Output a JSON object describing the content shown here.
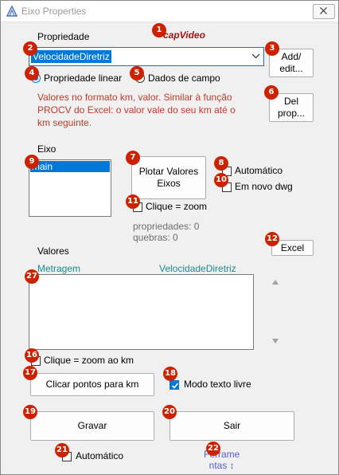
{
  "window": {
    "title": "Eixo Properties"
  },
  "brand": {
    "text": "capVideo"
  },
  "propriedade": {
    "label": "Propriedade",
    "selected": "VelocidadeDiretriz",
    "add_label": "Add/\nedit...",
    "option_linear": "Propriedade linear",
    "option_campo": "Dados de campo",
    "linear_checked": true,
    "info": "Valores no formato km, valor. Similar à função PROCV do Excel: o valor vale do seu km até o km seguinte.",
    "del_label": "Del\nprop..."
  },
  "eixo": {
    "label": "Eixo",
    "items": [
      "main"
    ],
    "plot_label": "Plotar Valores\nEixos",
    "automatico": "Automático",
    "em_novo_dwg": "Em novo dwg",
    "clique_zoom": "Clique = zoom",
    "propriedades": "propriedades: 0",
    "quebras": "quebras: 0"
  },
  "valores": {
    "label": "Valores",
    "excel_label": "Excel",
    "col_metragem": "Metragem",
    "col_valor": "VelocidadeDiretriz",
    "clique_zoom_km": "Clique = zoom ao km",
    "clicar_pontos": "Clicar pontos para km",
    "modo_texto_livre": "Modo texto livre",
    "modo_checked": true
  },
  "footer": {
    "gravar": "Gravar",
    "sair": "Sair",
    "automatico": "Automático",
    "ferramentas": "Ferrame\nntas ↕"
  },
  "markers": [
    "1",
    "2",
    "3",
    "4",
    "5",
    "6",
    "7",
    "8",
    "9",
    "10",
    "11",
    "12",
    "16",
    "17",
    "18",
    "19",
    "20",
    "21",
    "22",
    "27"
  ],
  "colors": {
    "accent": "#0078d7",
    "marker": "#cc2200",
    "info": "#c0392b",
    "teal": "#1a8a8a"
  }
}
